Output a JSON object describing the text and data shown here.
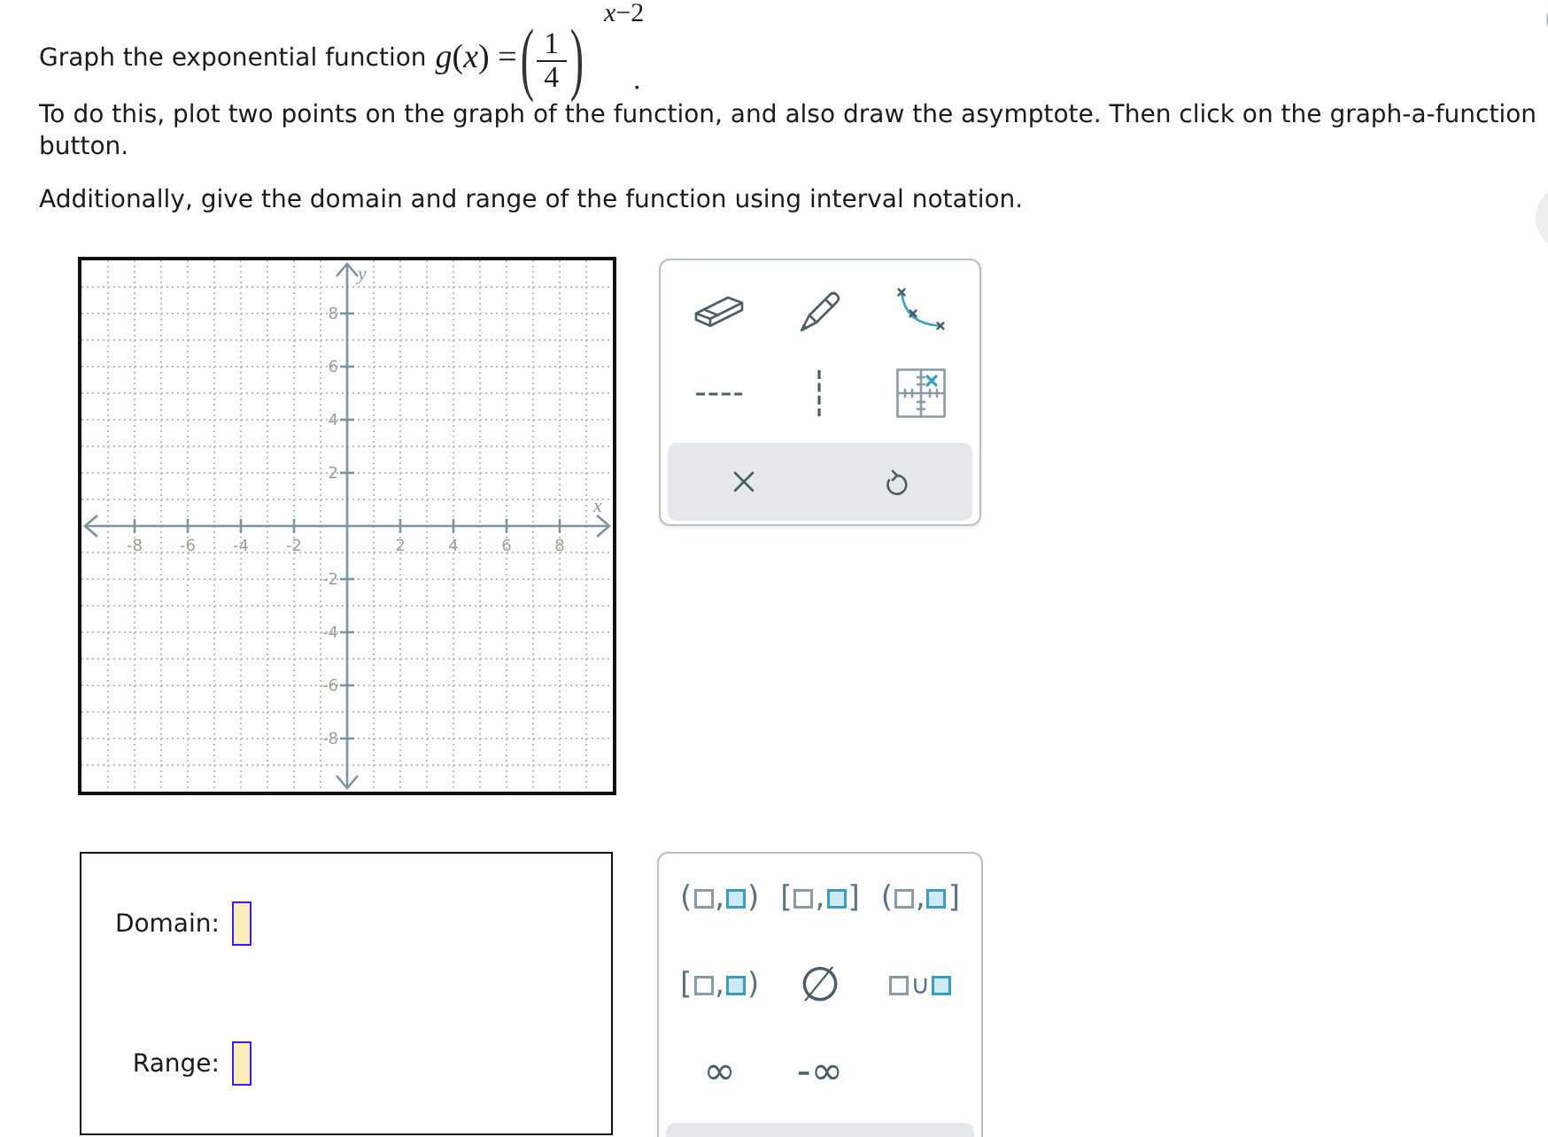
{
  "question": {
    "intro": "Graph the exponential function",
    "lhs": "*g*(*x*) =",
    "open_paren": "(",
    "numerator": "1",
    "denominator": "4",
    "close_paren": ")",
    "exponent": "*x*−2",
    "end_mark": "."
  },
  "instructions": "To do this, plot two points on the graph of the function, and also draw the asymptote. Then click on the graph-a-function button.",
  "additional": "Additionally, give the domain and range of the function using interval notation.",
  "graph": {
    "x_axis_label": "x",
    "y_axis_label": "y",
    "x_tick_labels": [
      "-8",
      "-6",
      "-4",
      "-2",
      "2",
      "4",
      "6",
      "8"
    ],
    "y_tick_labels": [
      "8",
      "6",
      "4",
      "2",
      "-2",
      "-4",
      "-6",
      "-8"
    ]
  },
  "graph_tools": [
    {
      "kind": "eraser"
    },
    {
      "kind": "pencil"
    },
    {
      "kind": "curve"
    },
    {
      "kind": "horizontal_dash"
    },
    {
      "kind": "vertical_dash"
    },
    {
      "kind": "grid_point"
    }
  ],
  "graph_actions": [
    {
      "kind": "clear"
    },
    {
      "kind": "undo"
    }
  ],
  "answers": [
    {
      "label": "Domain:"
    },
    {
      "label": "Range:"
    }
  ],
  "symbol_tools": [
    {
      "kind": "interval",
      "open": "(",
      "separator": ",",
      "close": ")"
    },
    {
      "kind": "interval",
      "open": "[",
      "separator": ",",
      "close": "]"
    },
    {
      "kind": "interval",
      "open": "(",
      "separator": ",",
      "close": "]"
    },
    {
      "kind": "interval",
      "open": "[",
      "separator": ",",
      "close": ")"
    },
    {
      "kind": "empty_set",
      "symbol": "∅"
    },
    {
      "kind": "union",
      "symbol": "∪"
    },
    {
      "kind": "infinity",
      "symbol": "∞"
    },
    {
      "kind": "negative_infinity",
      "symbol": "-∞"
    }
  ]
}
